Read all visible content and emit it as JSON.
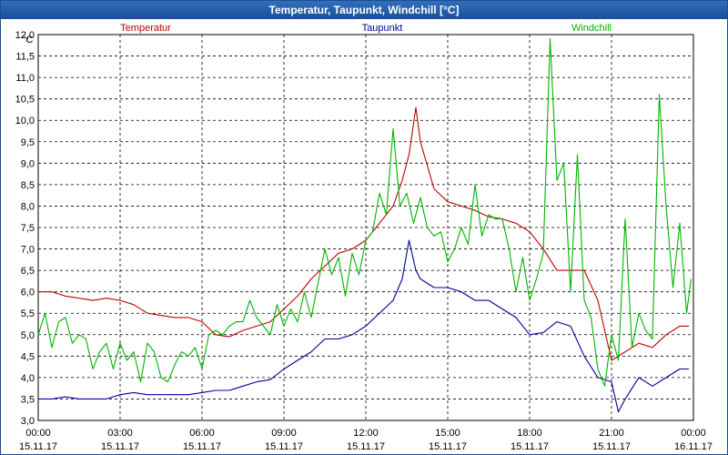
{
  "window": {
    "title": "Temperatur, Taupunkt, Windchill [°C]"
  },
  "chart_data": {
    "type": "line",
    "title": "Temperatur, Taupunkt, Windchill [°C]",
    "ylabel": "°C",
    "ylim": [
      3.0,
      12.0
    ],
    "ystep": 0.5,
    "yticks": [
      "3,0",
      "3,5",
      "4,0",
      "4,5",
      "5,0",
      "5,5",
      "6,0",
      "6,5",
      "7,0",
      "7,5",
      "8,0",
      "8,5",
      "9,0",
      "9,5",
      "10,0",
      "10,5",
      "11,0",
      "11,5",
      "12,0"
    ],
    "xlim": [
      "15.11.17 00:00",
      "16.11.17 00:00"
    ],
    "xticks": [
      {
        "time": "00:00",
        "date": "15.11.17"
      },
      {
        "time": "03:00",
        "date": "15.11.17"
      },
      {
        "time": "06:00",
        "date": "15.11.17"
      },
      {
        "time": "09:00",
        "date": "15.11.17"
      },
      {
        "time": "12:00",
        "date": "15.11.17"
      },
      {
        "time": "15:00",
        "date": "15.11.17"
      },
      {
        "time": "18:00",
        "date": "15.11.17"
      },
      {
        "time": "21:00",
        "date": "15.11.17"
      },
      {
        "time": "00:00",
        "date": "16.11.17"
      }
    ],
    "grid": true,
    "legend_position": "top",
    "series": [
      {
        "name": "Temperatur",
        "color": "#c00000",
        "x": [
          "15.11.17 00:00",
          "15.11.17 00:30",
          "15.11.17 01:00",
          "15.11.17 01:30",
          "15.11.17 02:00",
          "15.11.17 02:30",
          "15.11.17 03:00",
          "15.11.17 03:30",
          "15.11.17 04:00",
          "15.11.17 04:30",
          "15.11.17 05:00",
          "15.11.17 05:30",
          "15.11.17 06:00",
          "15.11.17 06:30",
          "15.11.17 07:00",
          "15.11.17 07:30",
          "15.11.17 08:00",
          "15.11.17 08:30",
          "15.11.17 09:00",
          "15.11.17 09:30",
          "15.11.17 10:00",
          "15.11.17 10:30",
          "15.11.17 11:00",
          "15.11.17 11:30",
          "15.11.17 12:00",
          "15.11.17 12:30",
          "15.11.17 13:00",
          "15.11.17 13:20",
          "15.11.17 13:35",
          "15.11.17 13:50",
          "15.11.17 14:00",
          "15.11.17 14:30",
          "15.11.17 15:00",
          "15.11.17 15:30",
          "15.11.17 16:00",
          "15.11.17 16:30",
          "15.11.17 17:00",
          "15.11.17 17:30",
          "15.11.17 18:00",
          "15.11.17 18:30",
          "15.11.17 19:00",
          "15.11.17 19:30",
          "15.11.17 20:00",
          "15.11.17 20:30",
          "15.11.17 21:00",
          "15.11.17 21:30",
          "15.11.17 22:00",
          "15.11.17 22:30",
          "15.11.17 23:00",
          "15.11.17 23:30",
          "15.11.17 23:50"
        ],
        "values": [
          6.0,
          6.0,
          5.9,
          5.85,
          5.8,
          5.85,
          5.8,
          5.7,
          5.5,
          5.45,
          5.4,
          5.4,
          5.3,
          5.0,
          4.95,
          5.1,
          5.2,
          5.3,
          5.6,
          5.9,
          6.3,
          6.6,
          6.9,
          7.0,
          7.2,
          7.6,
          8.0,
          8.6,
          9.2,
          10.3,
          9.5,
          8.4,
          8.1,
          8.0,
          7.9,
          7.75,
          7.7,
          7.6,
          7.4,
          7.0,
          6.5,
          6.5,
          6.5,
          5.8,
          4.4,
          4.6,
          4.8,
          4.7,
          5.0,
          5.2,
          5.2
        ]
      },
      {
        "name": "Taupunkt",
        "color": "#0000a0",
        "x": [
          "15.11.17 00:00",
          "15.11.17 00:30",
          "15.11.17 01:00",
          "15.11.17 01:30",
          "15.11.17 02:00",
          "15.11.17 02:30",
          "15.11.17 03:00",
          "15.11.17 03:30",
          "15.11.17 04:00",
          "15.11.17 04:30",
          "15.11.17 05:00",
          "15.11.17 05:30",
          "15.11.17 06:00",
          "15.11.17 06:30",
          "15.11.17 07:00",
          "15.11.17 07:30",
          "15.11.17 08:00",
          "15.11.17 08:30",
          "15.11.17 09:00",
          "15.11.17 09:30",
          "15.11.17 10:00",
          "15.11.17 10:30",
          "15.11.17 11:00",
          "15.11.17 11:30",
          "15.11.17 12:00",
          "15.11.17 12:30",
          "15.11.17 13:00",
          "15.11.17 13:20",
          "15.11.17 13:35",
          "15.11.17 13:50",
          "15.11.17 14:00",
          "15.11.17 14:30",
          "15.11.17 15:00",
          "15.11.17 15:30",
          "15.11.17 16:00",
          "15.11.17 16:30",
          "15.11.17 17:00",
          "15.11.17 17:30",
          "15.11.17 18:00",
          "15.11.17 18:30",
          "15.11.17 19:00",
          "15.11.17 19:30",
          "15.11.17 20:00",
          "15.11.17 20:30",
          "15.11.17 21:00",
          "15.11.17 21:15",
          "15.11.17 21:30",
          "15.11.17 22:00",
          "15.11.17 22:30",
          "15.11.17 23:00",
          "15.11.17 23:30",
          "15.11.17 23:50"
        ],
        "values": [
          3.5,
          3.5,
          3.55,
          3.5,
          3.5,
          3.5,
          3.6,
          3.65,
          3.6,
          3.6,
          3.6,
          3.6,
          3.65,
          3.7,
          3.7,
          3.8,
          3.9,
          3.95,
          4.2,
          4.4,
          4.6,
          4.9,
          4.9,
          5.0,
          5.2,
          5.5,
          5.8,
          6.3,
          7.2,
          6.5,
          6.3,
          6.1,
          6.1,
          6.0,
          5.8,
          5.8,
          5.6,
          5.4,
          5.0,
          5.05,
          5.3,
          5.2,
          4.5,
          4.0,
          3.9,
          3.2,
          3.5,
          4.0,
          3.8,
          4.0,
          4.2,
          4.2
        ]
      },
      {
        "name": "Windchill",
        "color": "#00b400",
        "x": [
          "15.11.17 00:00",
          "15.11.17 00:15",
          "15.11.17 00:30",
          "15.11.17 00:45",
          "15.11.17 01:00",
          "15.11.17 01:15",
          "15.11.17 01:30",
          "15.11.17 01:45",
          "15.11.17 02:00",
          "15.11.17 02:15",
          "15.11.17 02:30",
          "15.11.17 02:45",
          "15.11.17 03:00",
          "15.11.17 03:15",
          "15.11.17 03:30",
          "15.11.17 03:45",
          "15.11.17 04:00",
          "15.11.17 04:15",
          "15.11.17 04:30",
          "15.11.17 04:45",
          "15.11.17 05:00",
          "15.11.17 05:15",
          "15.11.17 05:30",
          "15.11.17 05:45",
          "15.11.17 06:00",
          "15.11.17 06:15",
          "15.11.17 06:30",
          "15.11.17 06:45",
          "15.11.17 07:00",
          "15.11.17 07:15",
          "15.11.17 07:30",
          "15.11.17 07:45",
          "15.11.17 08:00",
          "15.11.17 08:15",
          "15.11.17 08:30",
          "15.11.17 08:45",
          "15.11.17 09:00",
          "15.11.17 09:15",
          "15.11.17 09:30",
          "15.11.17 09:45",
          "15.11.17 10:00",
          "15.11.17 10:15",
          "15.11.17 10:30",
          "15.11.17 10:45",
          "15.11.17 11:00",
          "15.11.17 11:15",
          "15.11.17 11:30",
          "15.11.17 11:45",
          "15.11.17 12:00",
          "15.11.17 12:15",
          "15.11.17 12:30",
          "15.11.17 12:45",
          "15.11.17 13:00",
          "15.11.17 13:15",
          "15.11.17 13:30",
          "15.11.17 13:45",
          "15.11.17 14:00",
          "15.11.17 14:15",
          "15.11.17 14:30",
          "15.11.17 14:45",
          "15.11.17 15:00",
          "15.11.17 15:15",
          "15.11.17 15:30",
          "15.11.17 15:45",
          "15.11.17 16:00",
          "15.11.17 16:15",
          "15.11.17 16:30",
          "15.11.17 16:45",
          "15.11.17 17:00",
          "15.11.17 17:15",
          "15.11.17 17:30",
          "15.11.17 17:45",
          "15.11.17 18:00",
          "15.11.17 18:15",
          "15.11.17 18:30",
          "15.11.17 18:45",
          "15.11.17 19:00",
          "15.11.17 19:15",
          "15.11.17 19:30",
          "15.11.17 19:45",
          "15.11.17 20:00",
          "15.11.17 20:15",
          "15.11.17 20:30",
          "15.11.17 20:45",
          "15.11.17 21:00",
          "15.11.17 21:15",
          "15.11.17 21:30",
          "15.11.17 21:45",
          "15.11.17 22:00",
          "15.11.17 22:15",
          "15.11.17 22:30",
          "15.11.17 22:45",
          "15.11.17 23:00",
          "15.11.17 23:15",
          "15.11.17 23:30",
          "15.11.17 23:45",
          "15.11.17 23:55"
        ],
        "values": [
          5.0,
          5.5,
          4.7,
          5.3,
          5.4,
          4.8,
          5.0,
          4.9,
          4.2,
          4.6,
          4.8,
          4.2,
          4.8,
          4.4,
          4.6,
          3.9,
          4.8,
          4.6,
          4.0,
          3.9,
          4.3,
          4.6,
          4.5,
          4.7,
          4.2,
          5.0,
          5.1,
          5.0,
          5.2,
          5.3,
          5.3,
          5.8,
          5.4,
          5.2,
          5.0,
          5.7,
          5.2,
          5.6,
          5.3,
          6.0,
          5.4,
          6.2,
          7.0,
          6.4,
          6.8,
          5.9,
          6.9,
          6.4,
          7.2,
          7.4,
          8.3,
          7.8,
          9.8,
          8.0,
          8.3,
          7.6,
          8.2,
          7.5,
          7.3,
          7.4,
          6.7,
          7.0,
          7.5,
          7.1,
          8.5,
          7.3,
          7.8,
          7.7,
          7.7,
          7.0,
          6.0,
          6.8,
          5.8,
          6.3,
          6.9,
          11.9,
          8.6,
          9.0,
          6.0,
          9.2,
          5.8,
          5.4,
          4.2,
          3.8,
          5.0,
          4.4,
          7.7,
          4.7,
          5.5,
          5.1,
          4.9,
          10.6,
          8.0,
          6.1,
          7.6,
          5.5,
          6.3
        ]
      }
    ]
  }
}
